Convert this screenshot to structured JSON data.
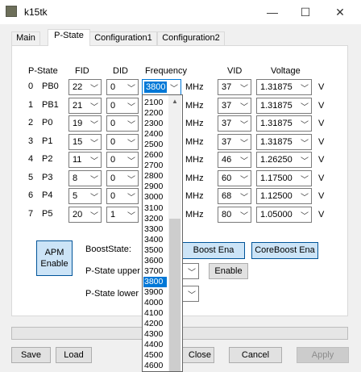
{
  "window": {
    "title": "k15tk",
    "minimize": "—",
    "maximize": "☐",
    "close": "✕"
  },
  "tabs": [
    "Main",
    "P-State",
    "Configuration1",
    "Configuration2"
  ],
  "headers": {
    "pstate": "P-State",
    "fid": "FID",
    "did": "DID",
    "frequency": "Frequency",
    "vid": "VID",
    "voltage": "Voltage"
  },
  "rows": [
    {
      "idx": "0",
      "name": "PB0",
      "fid": "22",
      "did": "0",
      "freq": "3800",
      "vid": "37",
      "volt": "1.31875"
    },
    {
      "idx": "1",
      "name": "PB1",
      "fid": "21",
      "did": "0",
      "freq": "",
      "vid": "37",
      "volt": "1.31875"
    },
    {
      "idx": "2",
      "name": "P0",
      "fid": "19",
      "did": "0",
      "freq": "",
      "vid": "37",
      "volt": "1.31875"
    },
    {
      "idx": "3",
      "name": "P1",
      "fid": "15",
      "did": "0",
      "freq": "",
      "vid": "37",
      "volt": "1.31875"
    },
    {
      "idx": "4",
      "name": "P2",
      "fid": "11",
      "did": "0",
      "freq": "",
      "vid": "46",
      "volt": "1.26250"
    },
    {
      "idx": "5",
      "name": "P3",
      "fid": "8",
      "did": "0",
      "freq": "",
      "vid": "60",
      "volt": "1.17500"
    },
    {
      "idx": "6",
      "name": "P4",
      "fid": "5",
      "did": "0",
      "freq": "",
      "vid": "68",
      "volt": "1.12500"
    },
    {
      "idx": "7",
      "name": "P5",
      "fid": "20",
      "did": "1",
      "freq": "",
      "vid": "80",
      "volt": "1.05000"
    }
  ],
  "units": {
    "mhz": "MHz",
    "v": "V"
  },
  "apm": {
    "line1": "APM",
    "line2": "Enable"
  },
  "boost": {
    "state_label": "BoostState:",
    "boost_button": "Boost Ena",
    "coreboost_button": "CoreBoost Ena",
    "upper_label": "P-State upper",
    "lower_label": "P-State lower",
    "enable_button": "Enable"
  },
  "bottom": {
    "save": "Save",
    "load": "Load",
    "close": "Close",
    "cancel": "Cancel",
    "apply": "Apply"
  },
  "frequency_options": [
    "2100",
    "2200",
    "2300",
    "2400",
    "2500",
    "2600",
    "2700",
    "2800",
    "2900",
    "3000",
    "3100",
    "3200",
    "3300",
    "3400",
    "3500",
    "3600",
    "3700",
    "3800",
    "3900",
    "4000",
    "4100",
    "4200",
    "4300",
    "4400",
    "4500",
    "4600"
  ],
  "frequency_selected": "3800",
  "colors": {
    "accent": "#0078d7",
    "button_blue": "#cce4f7"
  }
}
